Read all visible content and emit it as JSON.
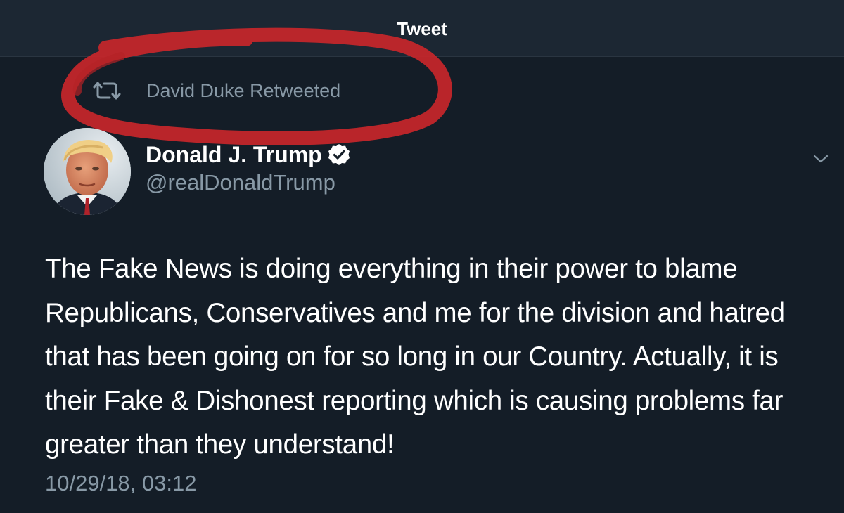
{
  "header": {
    "title": "Tweet"
  },
  "retweet": {
    "label": "David Duke Retweeted",
    "icon": "retweet-icon"
  },
  "annotation": {
    "color": "#c8262a",
    "shape": "hand-drawn-circle"
  },
  "author": {
    "name": "Donald J. Trump",
    "handle": "@realDonaldTrump",
    "verified": true,
    "avatar": "profile-photo"
  },
  "tweet": {
    "text": "The Fake News is doing everything in their power to blame Republicans, Conservatives and me for the division and hatred that has been going on for so long in our Country. Actually, it is their Fake & Dishonest reporting which is causing problems far greater than they understand!",
    "timestamp": "10/29/18, 03:12"
  },
  "colors": {
    "background": "#141d27",
    "header_background": "#1c2733",
    "secondary_text": "#8899a6",
    "primary_text": "#ffffff"
  }
}
